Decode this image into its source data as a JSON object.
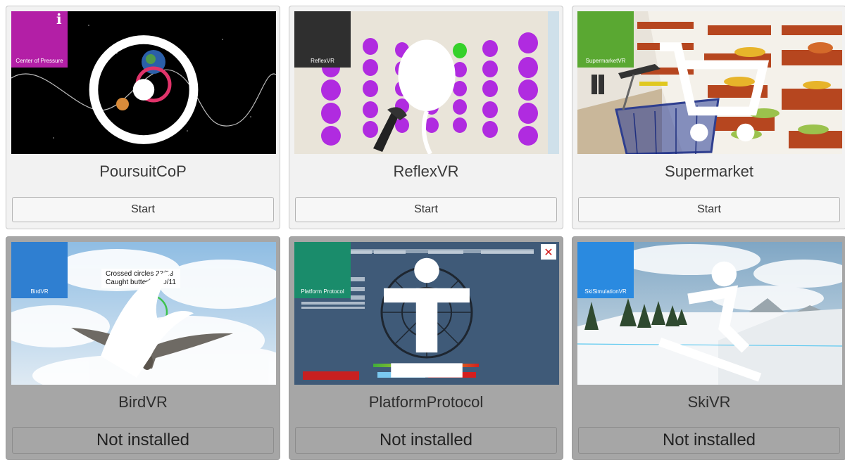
{
  "games": [
    {
      "title": "PoursuitCoP",
      "button": "Start",
      "installed": true,
      "badge_label": "Center of Pressure",
      "badge_color": "#b31fa6",
      "badge_icon": "target-icon"
    },
    {
      "title": "ReflexVR",
      "button": "Start",
      "installed": true,
      "badge_label": "ReflexVR",
      "badge_color": "#2f2f2f",
      "badge_icon": "balloon-icon"
    },
    {
      "title": "Supermarket",
      "button": "Start",
      "installed": true,
      "badge_label": "SupermarketVR",
      "badge_color": "#5aa832",
      "badge_icon": "cart-icon"
    },
    {
      "title": "BirdVR",
      "button": "Not installed",
      "installed": false,
      "badge_label": "BirdVR",
      "badge_color": "#2f7fd1",
      "badge_icon": "bird-icon",
      "overlay_lines": [
        "Crossed circles  23/23",
        "Caught butterflies  0/11"
      ]
    },
    {
      "title": "PlatformProtocol",
      "button": "Not installed",
      "installed": false,
      "badge_label": "Platform Protocol",
      "badge_color": "#1a8c6b",
      "badge_icon": "person-icon"
    },
    {
      "title": "SkiVR",
      "button": "Not installed",
      "installed": false,
      "badge_label": "SkiSimulationVR",
      "badge_color": "#2a8ae0",
      "badge_icon": "skier-icon"
    }
  ]
}
